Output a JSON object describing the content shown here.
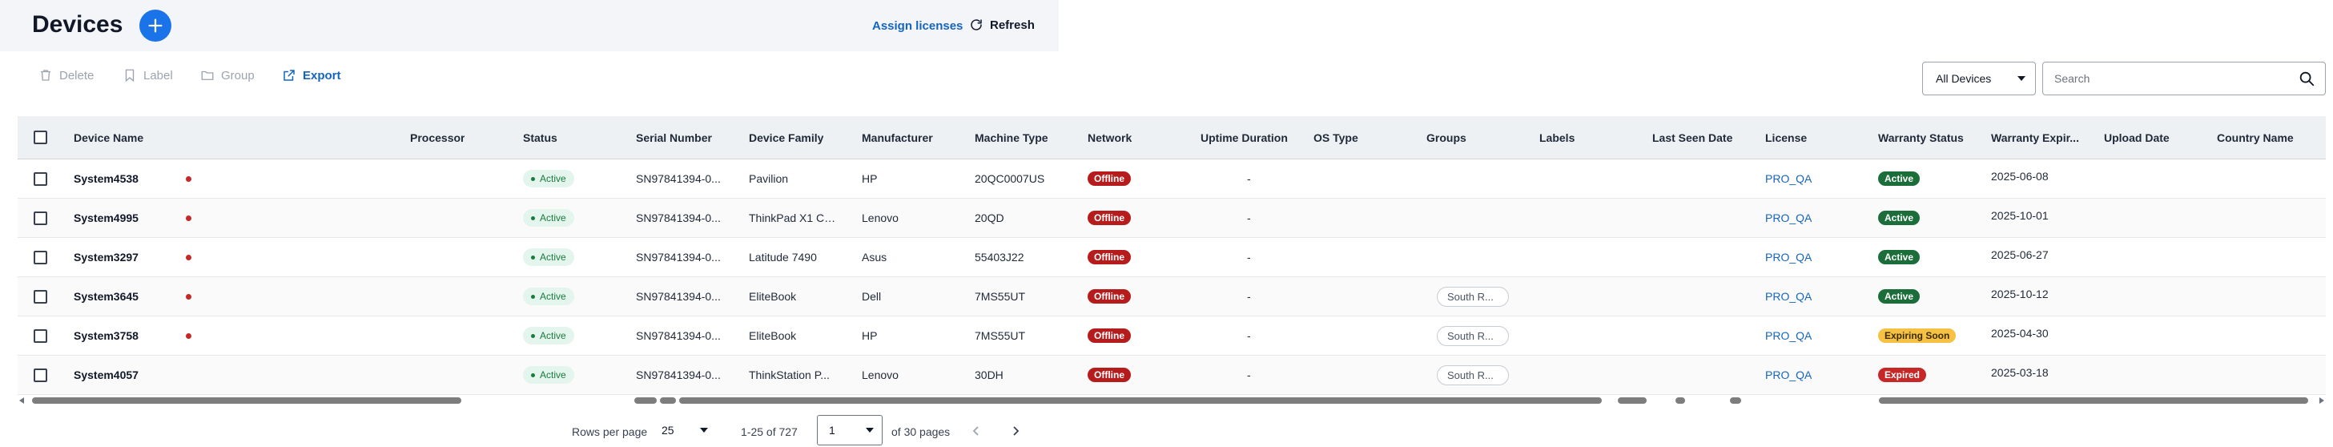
{
  "header": {
    "title": "Devices",
    "assign_licenses": "Assign licenses",
    "refresh": "Refresh"
  },
  "toolbar": {
    "delete": "Delete",
    "label": "Label",
    "group": "Group",
    "export": "Export"
  },
  "filter": {
    "selected": "All Devices"
  },
  "search": {
    "placeholder": "Search",
    "value": ""
  },
  "table": {
    "columns": [
      "Device Name",
      "Processor",
      "Status",
      "Serial Number",
      "Device Family",
      "Manufacturer",
      "Machine Type",
      "Network",
      "Uptime Duration",
      "OS Type",
      "Groups",
      "Labels",
      "Last Seen Date",
      "License",
      "Warranty Status",
      "Warranty Expir...",
      "Upload Date",
      "Country Name"
    ],
    "rows": [
      {
        "name": "System4538",
        "status": "Active",
        "serial": "SN97841394-0...",
        "family": "Pavilion",
        "manufacturer": "HP",
        "machine_type": "20QC0007US",
        "network": "Offline",
        "uptime": "-",
        "group": "",
        "license": "PRO_QA",
        "warranty_status": "Active",
        "warranty_expiry": "2025-06-08",
        "dot": true
      },
      {
        "name": "System4995",
        "status": "Active",
        "serial": "SN97841394-0...",
        "family": "ThinkPad X1 Ca...",
        "manufacturer": "Lenovo",
        "machine_type": "20QD",
        "network": "Offline",
        "uptime": "-",
        "group": "",
        "license": "PRO_QA",
        "warranty_status": "Active",
        "warranty_expiry": "2025-10-01",
        "dot": true
      },
      {
        "name": "System3297",
        "status": "Active",
        "serial": "SN97841394-0...",
        "family": "Latitude 7490",
        "manufacturer": "Asus",
        "machine_type": "55403J22",
        "network": "Offline",
        "uptime": "-",
        "group": "",
        "license": "PRO_QA",
        "warranty_status": "Active",
        "warranty_expiry": "2025-06-27",
        "dot": true
      },
      {
        "name": "System3645",
        "status": "Active",
        "serial": "SN97841394-0...",
        "family": "EliteBook",
        "manufacturer": "Dell",
        "machine_type": "7MS55UT",
        "network": "Offline",
        "uptime": "-",
        "group": "South R...",
        "license": "PRO_QA",
        "warranty_status": "Active",
        "warranty_expiry": "2025-10-12",
        "dot": true
      },
      {
        "name": "System3758",
        "status": "Active",
        "serial": "SN97841394-0...",
        "family": "EliteBook",
        "manufacturer": "HP",
        "machine_type": "7MS55UT",
        "network": "Offline",
        "uptime": "-",
        "group": "South R...",
        "license": "PRO_QA",
        "warranty_status": "Expiring Soon",
        "warranty_expiry": "2025-04-30",
        "dot": true
      },
      {
        "name": "System4057",
        "status": "Active",
        "serial": "SN97841394-0...",
        "family": "ThinkStation P...",
        "manufacturer": "Lenovo",
        "machine_type": "30DH",
        "network": "Offline",
        "uptime": "-",
        "group": "South R...",
        "license": "PRO_QA",
        "warranty_status": "Expired",
        "warranty_expiry": "2025-03-18",
        "dot": false
      }
    ]
  },
  "pagination": {
    "rows_per_page_label": "Rows per page",
    "rows_per_page": "25",
    "range": "1-25 of 727",
    "page": "1",
    "of_pages": "of 30 pages"
  },
  "colors": {
    "accent": "#1a73e8",
    "link": "#1565c0",
    "offline": "#b71c1c",
    "warranty_active": "#1b6e3a",
    "expiring": "#f6c244",
    "expired": "#c62828"
  }
}
